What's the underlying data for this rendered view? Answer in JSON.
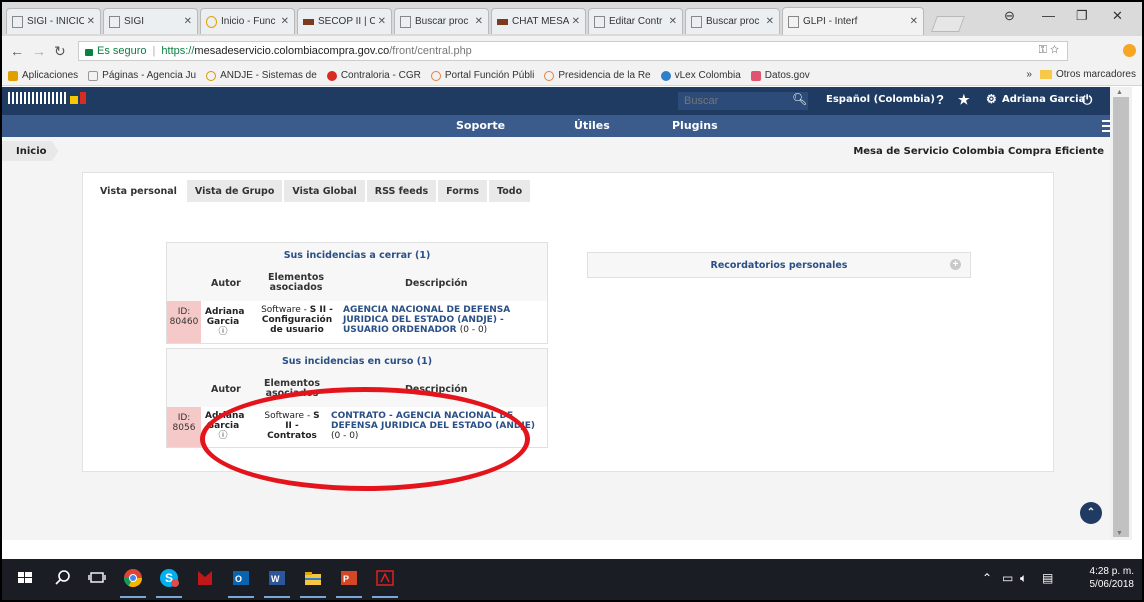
{
  "browser": {
    "tabs": [
      {
        "label": "SIGI - INICIO",
        "active": false
      },
      {
        "label": "SIGI",
        "active": false
      },
      {
        "label": "Inicio - Func",
        "active": false
      },
      {
        "label": "SECOP II | C",
        "active": false
      },
      {
        "label": "Buscar proc",
        "active": false
      },
      {
        "label": "CHAT MESA",
        "active": false
      },
      {
        "label": "Editar Contr",
        "active": false
      },
      {
        "label": "Buscar proc",
        "active": false
      },
      {
        "label": "GLPI - Interf",
        "active": true
      }
    ],
    "address": {
      "secure_label": "Es seguro",
      "url_protocol": "https://",
      "url_host": "mesadeservicio.colombiacompra.gov.co",
      "url_path": "/front/central.php"
    },
    "bookmarks": [
      {
        "label": "Aplicaciones",
        "icon": "apps-grid-icon",
        "color": "#e0a100"
      },
      {
        "label": "Páginas - Agencia Ju",
        "icon": "page-icon",
        "color": "#999999"
      },
      {
        "label": "ANDJE - Sistemas de",
        "icon": "andje-icon",
        "color": "#d29a00"
      },
      {
        "label": "Contraloria - CGR",
        "icon": "cgr-icon",
        "color": "#d62d20"
      },
      {
        "label": "Portal Función Públi",
        "icon": "funcion-publica-icon",
        "color": "#e8803a"
      },
      {
        "label": "Presidencia de la Re",
        "icon": "presidencia-icon",
        "color": "#e8803a"
      },
      {
        "label": "vLex Colombia",
        "icon": "vlex-icon",
        "color": "#2f80c8"
      },
      {
        "label": "Datos.gov",
        "icon": "datos-icon",
        "color": "#e0546f"
      }
    ],
    "bookmarks_more": "»",
    "other_bookmarks": "Otros marcadores"
  },
  "app": {
    "search_placeholder": "Buscar",
    "language": "Español (Colombia)",
    "help": "?",
    "user": "Adriana Garcia",
    "menu": [
      "Soporte",
      "Útiles",
      "Plugins"
    ],
    "breadcrumb": "Inicio",
    "entity": "Mesa de Servicio Colombia Compra Eficiente",
    "view_tabs": [
      "Vista personal",
      "Vista de Grupo",
      "Vista Global",
      "RSS feeds",
      "Forms",
      "Todo"
    ],
    "to_close": {
      "title": "Sus incidencias a cerrar (1)",
      "headers": {
        "author": "Autor",
        "items": "Elementos asociados",
        "description": "Descripción"
      },
      "row": {
        "id_label": "ID:",
        "id": "80460",
        "author_first": "Adriana",
        "author_last": "Garcia",
        "info": "ⓘ",
        "item_prefix": "Software - ",
        "item_bold_1": "S II -",
        "item_bold_2": "Configuración",
        "item_bold_3": "de usuario",
        "desc_1": "AGENCIA NACIONAL DE DEFENSA",
        "desc_2": "JURIDICA DEL ESTADO (ANDJE) -",
        "desc_3": "USUARIO ORDENADOR",
        "count": "(0 - 0)"
      }
    },
    "in_progress": {
      "title": "Sus incidencias en curso (1)",
      "headers": {
        "author": "Autor",
        "items": "Elementos asociados",
        "description": "Descripción"
      },
      "row": {
        "id_label": "ID:",
        "id": "8056",
        "author_first": "Adriana",
        "author_last": "Garcia",
        "info": "ⓘ",
        "item_prefix": "Software - ",
        "item_bold_1": "S",
        "item_bold_2": "II -",
        "item_bold_3": "Contratos",
        "desc_1": "CONTRATO - AGENCIA NACIONAL DE",
        "desc_2": "DEFENSA JURIDICA DEL ESTADO (ANDJE)",
        "count": "(0 - 0)"
      }
    },
    "reminders": {
      "title": "Recordatorios personales",
      "add": "+"
    }
  },
  "taskbar": {
    "time": "4:28 p. m.",
    "date": "5/06/2018"
  },
  "colors": {
    "header": "#1f3b62",
    "menubar": "#3a5b8c",
    "link": "#2a4f86",
    "highlight": "#e3141b",
    "id_cell": "#f6c9c9"
  }
}
